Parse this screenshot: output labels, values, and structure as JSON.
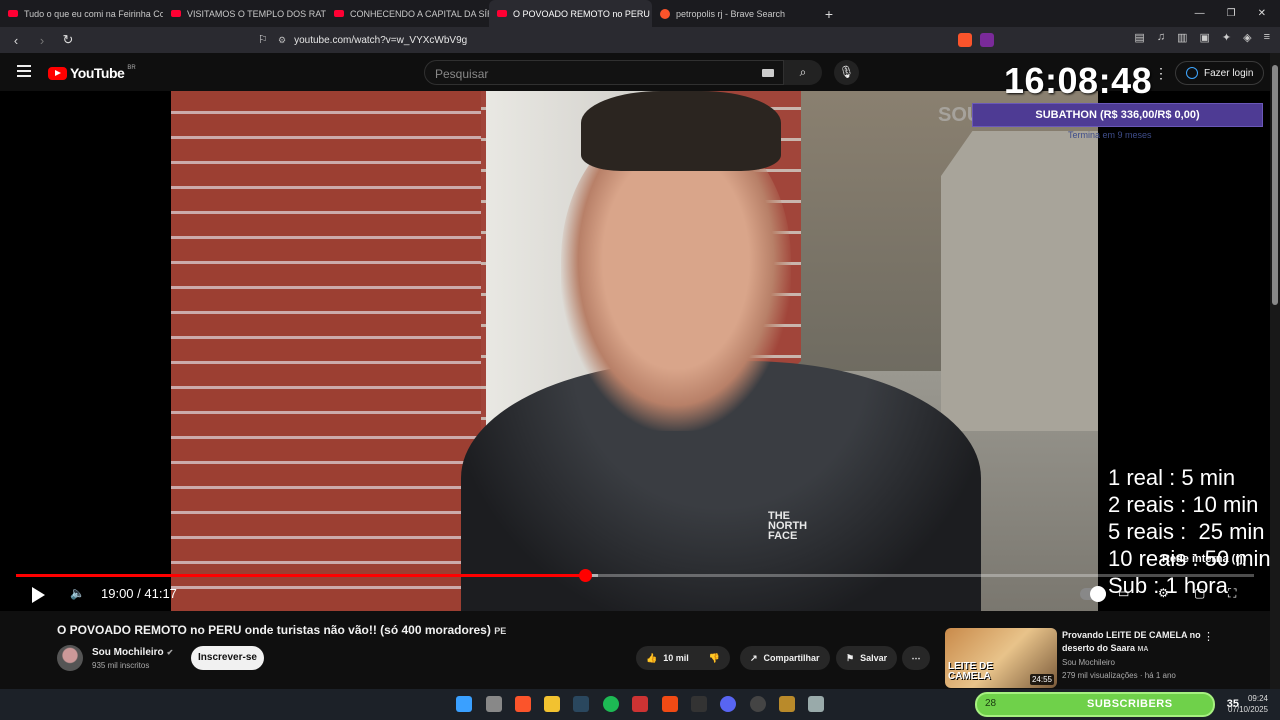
{
  "browser": {
    "tabs": [
      {
        "label": "Tudo o que eu comi na Feirinha Com",
        "active": false
      },
      {
        "label": "VISITAMOS O TEMPLO DOS RATOS N",
        "active": false
      },
      {
        "label": "CONHECENDO A CAPITAL DA SÍRIA",
        "active": false
      },
      {
        "label": "O POVOADO REMOTO no PERU",
        "active": true
      },
      {
        "label": "petropolis rj - Brave Search",
        "active": false
      }
    ],
    "new_tab": "+",
    "url": "youtube.com/watch?v=w_VYXcWbV9g"
  },
  "youtube": {
    "logo_word": "YouTube",
    "country": "BR",
    "search_placeholder": "Pesquisar",
    "login_label": "Fazer login"
  },
  "stream_overlay": {
    "clock": "16:08:48",
    "subathon": "SUBATHON (R$ 336,00/R$ 0,00)",
    "termina": "Termina em 9 meses",
    "rates": "1 real : 5 min\n2 reais : 10 min\n5 reais :  25 min\n10 reais : 50 min\nSub : 1 hora",
    "rede": "Rede interna (rj)",
    "subscribers_count": "28",
    "subscribers_label": "SUBSCRIBERS",
    "subscribers_total": "35"
  },
  "video": {
    "watermark": "SOU",
    "shirt_logo": "THE\nNORTH\nFACE",
    "current_time": "19:00",
    "duration": "41:17",
    "time_display": "19:00 / 41:17",
    "progress_fraction": 0.46,
    "buffered_fraction": 0.47,
    "title": "O POVOADO REMOTO no PERU onde turistas não vão!! (só 400 moradores)",
    "title_suffix": "PE"
  },
  "channel": {
    "name": "Sou Mochileiro",
    "subscribers": "935 mil inscritos",
    "subscribe_label": "Inscrever-se"
  },
  "actions": {
    "likes": "10 mil",
    "share": "Compartilhar",
    "save": "Salvar",
    "more": "⋯"
  },
  "recommendation": {
    "title": "Provando LEITE DE CAMELA no deserto do Saara",
    "badge": "MA",
    "thumb_caption": "LEITE DE CAMELA",
    "duration": "24:55",
    "channel": "Sou Mochileiro",
    "meta": "279 mil visualizações · há 1 ano"
  },
  "system": {
    "time": "09:24",
    "date": "07/10/2025"
  },
  "colors": {
    "yt_red": "#ff0000",
    "subathon_purple": "#4e3b94",
    "subbar_green": "#6fd14a",
    "background": "#0f0f0f"
  }
}
